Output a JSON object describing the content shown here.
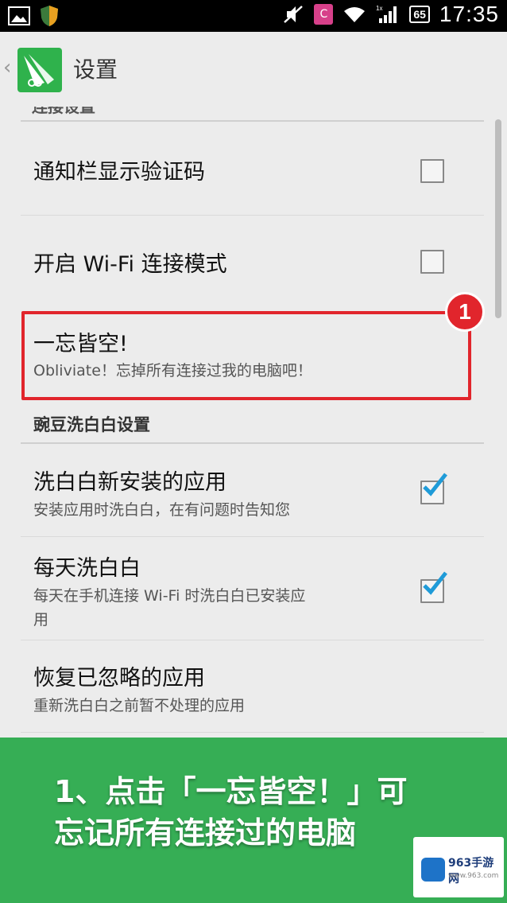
{
  "status_bar": {
    "time": "17:35",
    "battery": "65",
    "notif_letter": "C"
  },
  "action_bar": {
    "back_glyph": "‹",
    "title": "设置"
  },
  "list": {
    "cut_header": "连接设置",
    "items": [
      {
        "title": "通知栏显示验证码",
        "checked": false
      },
      {
        "title": "开启 Wi-Fi 连接模式",
        "checked": false
      },
      {
        "title": "一忘皆空!",
        "summary": "Obliviate！忘掉所有连接过我的电脑吧！"
      }
    ],
    "section2_title": "豌豆洗白白设置",
    "items2": [
      {
        "title": "洗白白新安装的应用",
        "summary": "安装应用时洗白白，在有问题时告知您",
        "checked": true
      },
      {
        "title": "每天洗白白",
        "summary_line1": "每天在手机连接 Wi-Fi 时洗白白已安装应",
        "summary_line2": "用",
        "checked": true
      },
      {
        "title": "恢复已忽略的应用",
        "summary": "重新洗白白之前暂不处理的应用"
      }
    ]
  },
  "annotation": {
    "badge_number": "1"
  },
  "caption": {
    "line1": "1、点击「一忘皆空！」可",
    "line2": "忘记所有连接过的电脑"
  },
  "watermark": {
    "text": "963手游网",
    "sub": "www.963.com"
  },
  "colors": {
    "accent_green": "#2fb24c",
    "highlight_red": "#e1252c",
    "check_blue": "#1f9bd8"
  }
}
